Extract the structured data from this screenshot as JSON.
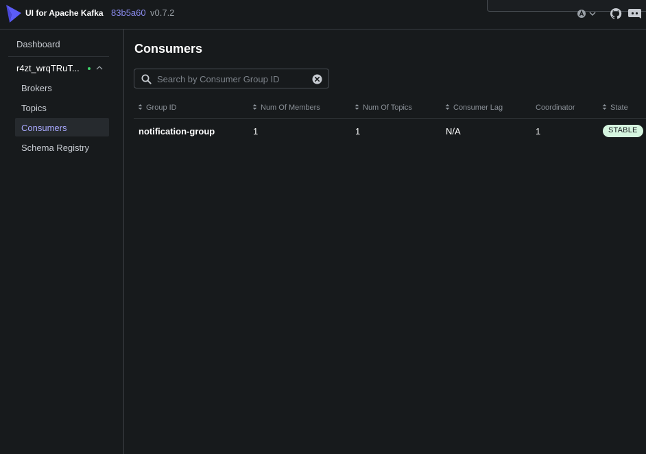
{
  "header": {
    "app_title": "UI for Apache Kafka",
    "version_hash": "83b5a60",
    "version_number": "v0.7.2",
    "accent_color": "#8b8cf0",
    "icons": [
      "kafka-logo",
      "theme-toggle-icon",
      "chevron-down-icon",
      "github-icon",
      "discord-icon"
    ]
  },
  "sidebar": {
    "dashboard_label": "Dashboard",
    "cluster": {
      "name": "r4zt_wrqTRuT...",
      "status_color": "#3fd46a"
    },
    "items": [
      {
        "label": "Brokers",
        "active": false
      },
      {
        "label": "Topics",
        "active": false
      },
      {
        "label": "Consumers",
        "active": true
      },
      {
        "label": "Schema Registry",
        "active": false
      }
    ]
  },
  "main": {
    "title": "Consumers",
    "search": {
      "placeholder": "Search by Consumer Group ID",
      "value": ""
    },
    "table": {
      "columns": [
        {
          "label": "Group ID",
          "sortable": true
        },
        {
          "label": "Num Of Members",
          "sortable": true
        },
        {
          "label": "Num Of Topics",
          "sortable": true
        },
        {
          "label": "Consumer Lag",
          "sortable": true
        },
        {
          "label": "Coordinator",
          "sortable": false
        },
        {
          "label": "State",
          "sortable": true
        }
      ],
      "rows": [
        {
          "group_id": "notification-group",
          "num_members": "1",
          "num_topics": "1",
          "consumer_lag": "N/A",
          "coordinator": "1",
          "state": "STABLE"
        }
      ],
      "state_badge_color": "#d5f5df"
    }
  }
}
